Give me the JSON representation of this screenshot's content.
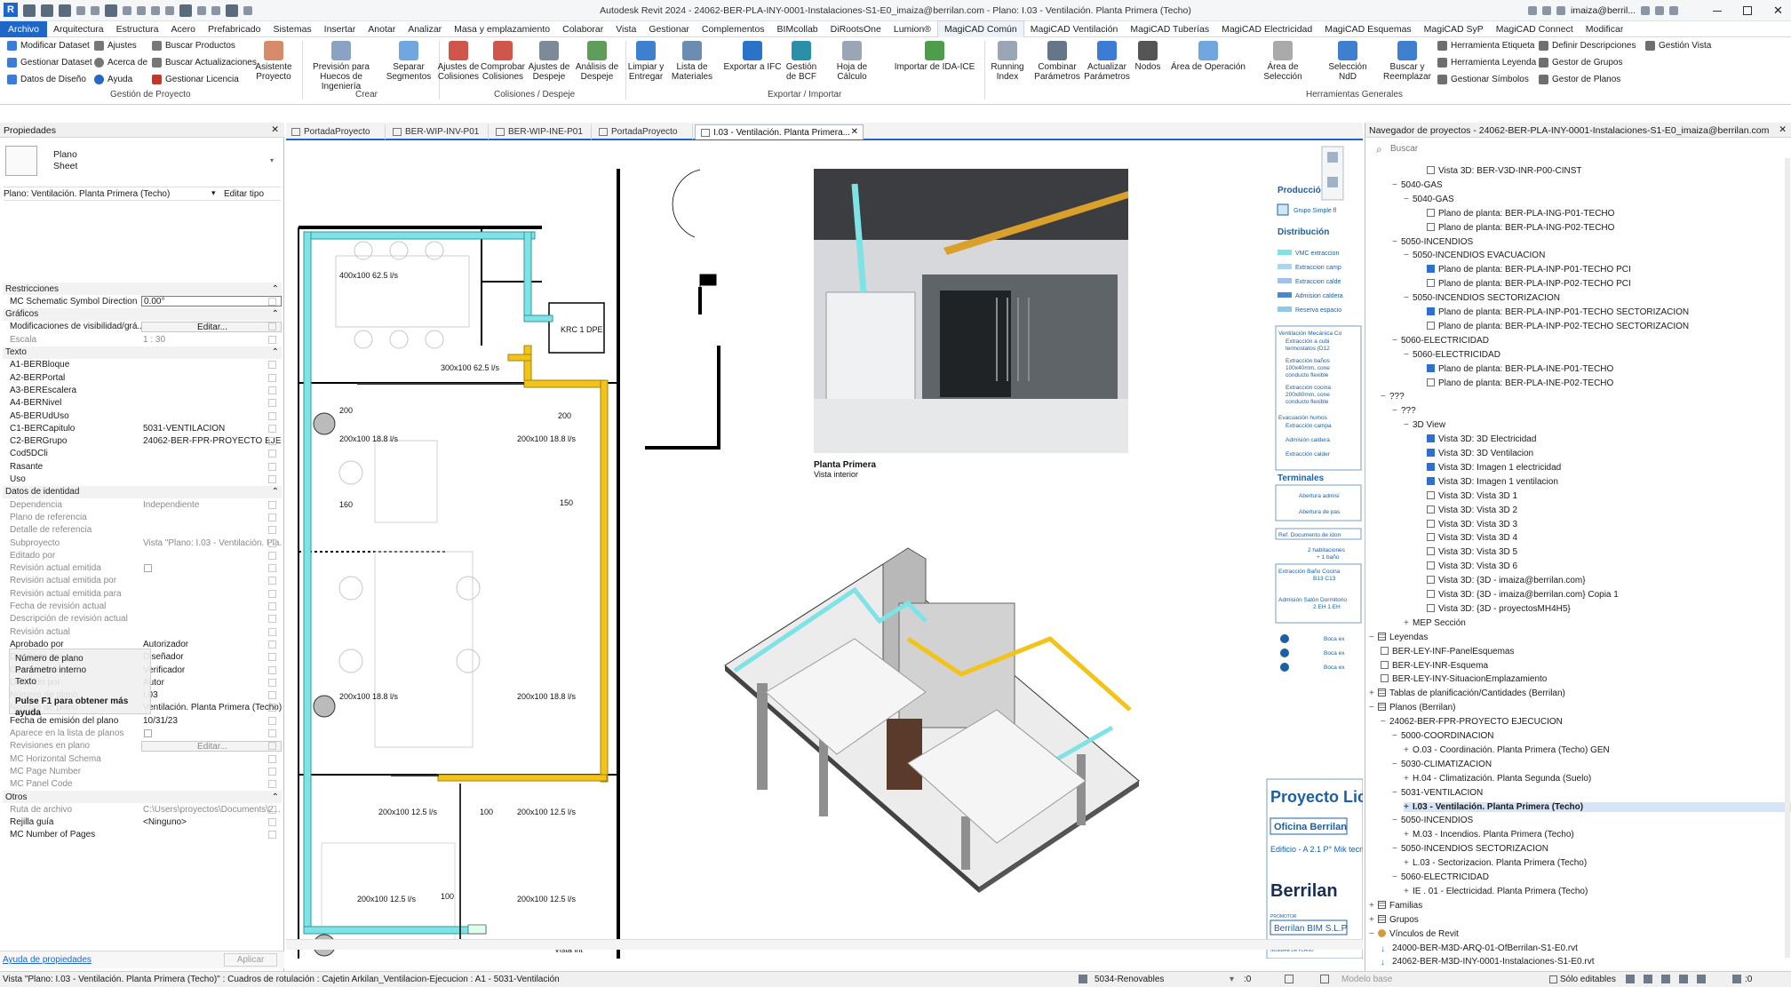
{
  "app": {
    "title": "Autodesk Revit 2024 - 24062-BER-PLA-INY-0001-Instalaciones-S1-E0_imaiza@berrilan.com - Plano: I.03 - Ventilación. Planta Primera (Techo)",
    "user": "imaiza@berril...",
    "logo": "R"
  },
  "menu": [
    "Archivo",
    "Arquitectura",
    "Estructura",
    "Acero",
    "Prefabricado",
    "Sistemas",
    "Insertar",
    "Anotar",
    "Analizar",
    "Masa y emplazamiento",
    "Colaborar",
    "Vista",
    "Gestionar",
    "Complementos",
    "BIMcollab",
    "DiRootsOne",
    "Lumion®",
    "MagiCAD Común",
    "MagiCAD Ventilación",
    "MagiCAD Tuberías",
    "MagiCAD Electricidad",
    "MagiCAD Esquemas",
    "MagiCAD SyP",
    "MagiCAD Connect",
    "Modificar"
  ],
  "ribbon": {
    "gestion_small": [
      "Modificar Dataset",
      "Gestionar Dataset",
      "Datos de Diseño",
      "Ajustes",
      "Acerca de",
      "Ayuda",
      "Buscar Productos",
      "Buscar Actualizaciones",
      "Gestionar Licencia"
    ],
    "asistente": "Asistente Proyecto",
    "crear": [
      "Previsión para Huecos de Ingeniería",
      "Separar Segmentos"
    ],
    "colisiones": [
      "Ajustes de Colisiones",
      "Comprobar Colisiones",
      "Ajustes de Despeje",
      "Análisis de Despeje"
    ],
    "exportar": [
      "Limpiar y Entregar",
      "Lista de Materiales",
      "Exportar a IFC",
      "Gestión de BCF",
      "Hoja de Cálculo",
      "Importar de IDA-ICE"
    ],
    "herramientas": [
      "Running Index",
      "Combinar Parámetros",
      "Actualizar Parámetros",
      "Nodos",
      "Área de Operación",
      "Área de Selección",
      "Selección NdD",
      "Buscar y Reemplazar"
    ],
    "herramientas_small": [
      "Herramienta Etiqueta",
      "Herramienta Leyenda",
      "Gestionar Símbolos",
      "Definir Descripciones",
      "Gestor de Grupos",
      "Gestor de Planos",
      "Gestión Vista"
    ],
    "groups": [
      "Gestión de Proyecto",
      "Crear",
      "Colisiones / Despeje",
      "Exportar / Importar",
      "Herramientas Generales"
    ]
  },
  "properties": {
    "header": "Propiedades",
    "type_name": "Plano",
    "type_sub": "Sheet",
    "selector": "Plano: Ventilación. Planta Primera (Techo)",
    "edit_type": "Editar tipo",
    "rows": [
      {
        "k": "Restricciones",
        "v": "",
        "cat": true
      },
      {
        "k": "MC Schematic Symbol Direction",
        "v": "0.00°",
        "box": true
      },
      {
        "k": "Gráficos",
        "v": "",
        "cat": true
      },
      {
        "k": "Modificaciones de visibilidad/grá...",
        "v": "Editar...",
        "btn": true
      },
      {
        "k": "Escala",
        "v": "1 : 30",
        "gray": true
      },
      {
        "k": "Texto",
        "v": "",
        "cat": true
      },
      {
        "k": "A1-BERBloque",
        "v": ""
      },
      {
        "k": "A2-BERPortal",
        "v": ""
      },
      {
        "k": "A3-BEREscalera",
        "v": ""
      },
      {
        "k": "A4-BERNivel",
        "v": ""
      },
      {
        "k": "A5-BERUdUso",
        "v": ""
      },
      {
        "k": "C1-BERCapitulo",
        "v": "5031-VENTILACION"
      },
      {
        "k": "C2-BERGrupo",
        "v": "24062-BER-FPR-PROYECTO EJECU..."
      },
      {
        "k": "Cod5DCli",
        "v": ""
      },
      {
        "k": "Rasante",
        "v": ""
      },
      {
        "k": "Uso",
        "v": ""
      },
      {
        "k": "Datos de identidad",
        "v": "",
        "cat": true
      },
      {
        "k": "Dependencia",
        "v": "Independiente",
        "gray": true
      },
      {
        "k": "Plano de referencia",
        "v": "",
        "gray": true
      },
      {
        "k": "Detalle de referencia",
        "v": "",
        "gray": true
      },
      {
        "k": "Subproyecto",
        "v": "Vista \"Plano: I.03 - Ventilación. Pla...",
        "gray": true
      },
      {
        "k": "Editado por",
        "v": "",
        "gray": true
      },
      {
        "k": "Revisión actual emitida",
        "v": "",
        "gray": true,
        "check": true
      },
      {
        "k": "Revisión actual emitida por",
        "v": "",
        "gray": true
      },
      {
        "k": "Revisión actual emitida para",
        "v": "",
        "gray": true
      },
      {
        "k": "Fecha de revisión actual",
        "v": "",
        "gray": true
      },
      {
        "k": "Descripción de revisión actual",
        "v": "",
        "gray": true
      },
      {
        "k": "Revisión actual",
        "v": "",
        "gray": true
      },
      {
        "k": "Aprobado por",
        "v": "Autorizador"
      },
      {
        "k": "Diseñado por",
        "v": "Diseñador"
      },
      {
        "k": "Comprobado por",
        "v": "Verificador"
      },
      {
        "k": "Dibujado por",
        "v": "Autor"
      },
      {
        "k": "Número de plano",
        "v": "I.03"
      },
      {
        "k": "Nombre de plano",
        "v": "Ventilación. Planta Primera (Techo)"
      },
      {
        "k": "Fecha de emisión del plano",
        "v": "10/31/23"
      },
      {
        "k": "Aparece en la lista de planos",
        "v": "",
        "check": true,
        "gray": true
      },
      {
        "k": "Revisiones en plano",
        "v": "Editar...",
        "btn": true,
        "gray": true
      },
      {
        "k": "MC Horizontal Schema",
        "v": "",
        "gray": true
      },
      {
        "k": "MC Page Number",
        "v": "",
        "gray": true
      },
      {
        "k": "MC Panel Code",
        "v": "",
        "gray": true
      },
      {
        "k": "Otros",
        "v": "",
        "cat": true
      },
      {
        "k": "Ruta de archivo",
        "v": "C:\\Users\\proyectos\\Documents\\2...",
        "gray": true
      },
      {
        "k": "Rejilla guía",
        "v": "<Ninguno>"
      },
      {
        "k": "MC Number of Pages",
        "v": ""
      }
    ],
    "tooltip": [
      "Número de plano",
      "Parámetro interno",
      "Texto"
    ],
    "tooltip_help": "Pulse F1 para obtener más ayuda",
    "help_link": "Ayuda de propiedades",
    "apply": "Aplicar"
  },
  "tabs": [
    {
      "label": "PortadaProyecto"
    },
    {
      "label": "BER-WIP-INV-P01"
    },
    {
      "label": "BER-WIP-INE-P01"
    },
    {
      "label": "PortadaProyecto"
    },
    {
      "label": "I.03 - Ventilación. Planta Primera..."
    }
  ],
  "drawing": {
    "plan_labels": [
      "400x100 62.5 l/s",
      "300x100 62.5 l/s",
      "200x100 18.8 l/s",
      "200x100 18.8 l/s",
      "200x100 18.8 l/s",
      "200x100 18.8 l/s",
      "200x100 12.5 l/s",
      "200x100 12.5 l/s",
      "200x100 12.5 l/s",
      "200x100 12.5 l/s",
      "200",
      "200",
      "160",
      "150",
      "100",
      "100",
      "KRC 1 DPE",
      "Vista int"
    ],
    "render_title": "Planta Primera",
    "render_sub": "Vista interior",
    "legend": {
      "produccion": "Producción",
      "grupo": "Grupo Simple fl",
      "distribucion": "Distribución",
      "dist_items": [
        "VMC extraccion",
        "Extraccion camp",
        "Extraccion calde",
        "Admision caldera",
        "Reserva espacio"
      ],
      "vent_note": [
        "Ventilación Mecánica Co",
        "Extracción a cubi",
        "termostatos (D12",
        "Extracción baños",
        "100x40mm, cone",
        "conducto flexible",
        "Extracción cocina",
        "200x80mm, cone",
        "conducto flexible"
      ],
      "evac": [
        "Evacuación humos",
        "Extracción campa",
        "Admisión caldera",
        "Extracción calder"
      ],
      "terminales": "Terminales",
      "term_items": [
        "Abertura admisi",
        "Abertura de pas"
      ],
      "ref": "Ref. Documento de idon",
      "hab": [
        "2 habitaciones",
        "+ 1 baño"
      ],
      "table": [
        "Extracción Baño Cocina",
        "B13 C13",
        "Admisión Salón Dormitorio",
        "2 EH 1 EH"
      ],
      "boca": [
        "Boca ex",
        "Boca ex",
        "Boca ex"
      ]
    },
    "title_block": {
      "project": "Proyecto Lic",
      "office": "Oficina Berrilan",
      "address": "Edificio - A 2.1 P° Mik tecnologico Miramon",
      "brand": "Berrilan",
      "promotor_label": "PROMOTOR",
      "promotor": "Berrilan BIM S.L.P",
      "consultor_label": "NOMBRE DE PLANO"
    }
  },
  "navigator": {
    "header": "Navegador de proyectos - 24062-BER-PLA-INY-0001-Instalaciones-S1-E0_imaiza@berrilan.com",
    "search_placeholder": "Buscar",
    "rows": [
      {
        "d": 4,
        "t": "Vista 3D: BER-V3D-INR-P00-CINST",
        "ic": "v"
      },
      {
        "d": 1,
        "t": "5040-GAS",
        "ex": "−"
      },
      {
        "d": 2,
        "t": "5040-GAS",
        "ex": "−"
      },
      {
        "d": 4,
        "t": "Plano de planta: BER-PLA-ING-P01-TECHO",
        "ic": "v"
      },
      {
        "d": 4,
        "t": "Plano de planta: BER-PLA-ING-P02-TECHO",
        "ic": "v"
      },
      {
        "d": 1,
        "t": "5050-INCENDIOS",
        "ex": "−"
      },
      {
        "d": 2,
        "t": "5050-INCENDIOS EVACUACION",
        "ex": "−"
      },
      {
        "d": 4,
        "t": "Plano de planta: BER-PLA-INP-P01-TECHO PCI",
        "ic": "b"
      },
      {
        "d": 4,
        "t": "Plano de planta: BER-PLA-INP-P02-TECHO PCI",
        "ic": "v"
      },
      {
        "d": 2,
        "t": "5050-INCENDIOS SECTORIZACION",
        "ex": "−"
      },
      {
        "d": 4,
        "t": "Plano de planta: BER-PLA-INP-P01-TECHO SECTORIZACION",
        "ic": "b"
      },
      {
        "d": 4,
        "t": "Plano de planta: BER-PLA-INP-P02-TECHO SECTORIZACION",
        "ic": "v"
      },
      {
        "d": 1,
        "t": "5060-ELECTRICIDAD",
        "ex": "−"
      },
      {
        "d": 2,
        "t": "5060-ELECTRICIDAD",
        "ex": "−"
      },
      {
        "d": 4,
        "t": "Plano de planta: BER-PLA-INE-P01-TECHO",
        "ic": "b"
      },
      {
        "d": 4,
        "t": "Plano de planta: BER-PLA-INE-P02-TECHO",
        "ic": "v"
      },
      {
        "d": 0,
        "t": "???",
        "ex": "−"
      },
      {
        "d": 1,
        "t": "???",
        "ex": "−"
      },
      {
        "d": 2,
        "t": "3D View",
        "ex": "−"
      },
      {
        "d": 4,
        "t": "Vista 3D: 3D Electricidad",
        "ic": "b"
      },
      {
        "d": 4,
        "t": "Vista 3D: 3D Ventilacion",
        "ic": "b"
      },
      {
        "d": 4,
        "t": "Vista 3D: Imagen 1 electricidad",
        "ic": "b"
      },
      {
        "d": 4,
        "t": "Vista 3D: Imagen 1 ventilacion",
        "ic": "b"
      },
      {
        "d": 4,
        "t": "Vista 3D: Vista 3D 1",
        "ic": "v"
      },
      {
        "d": 4,
        "t": "Vista 3D: Vista 3D 2",
        "ic": "v"
      },
      {
        "d": 4,
        "t": "Vista 3D: Vista 3D 3",
        "ic": "v"
      },
      {
        "d": 4,
        "t": "Vista 3D: Vista 3D 4",
        "ic": "v"
      },
      {
        "d": 4,
        "t": "Vista 3D: Vista 3D 5",
        "ic": "v"
      },
      {
        "d": 4,
        "t": "Vista 3D: Vista 3D 6",
        "ic": "v"
      },
      {
        "d": 4,
        "t": "Vista 3D: {3D - imaiza@berrilan.com}",
        "ic": "v"
      },
      {
        "d": 4,
        "t": "Vista 3D: {3D - imaiza@berrilan.com} Copia 1",
        "ic": "v"
      },
      {
        "d": 4,
        "t": "Vista 3D: {3D - proyectosMH4H5}",
        "ic": "v"
      },
      {
        "d": 2,
        "t": "MEP Sección",
        "ex": "+"
      },
      {
        "d": -1,
        "t": "Leyendas",
        "ex": "−",
        "ic": "t"
      },
      {
        "d": 0,
        "t": "BER-LEY-INF-PanelEsquemas",
        "ic": "v"
      },
      {
        "d": 0,
        "t": "BER-LEY-INR-Esquema",
        "ic": "v"
      },
      {
        "d": 0,
        "t": "BER-LEY-INY-SituacionEmplazamiento",
        "ic": "v"
      },
      {
        "d": -1,
        "t": "Tablas de planificación/Cantidades (Berrilan)",
        "ex": "+",
        "ic": "t"
      },
      {
        "d": -1,
        "t": "Planos (Berrilan)",
        "ex": "−",
        "ic": "t"
      },
      {
        "d": 0,
        "t": "24062-BER-FPR-PROYECTO EJECUCION",
        "ex": "−"
      },
      {
        "d": 1,
        "t": "5000-COORDINACION",
        "ex": "−"
      },
      {
        "d": 2,
        "t": "O.03 - Coordinación. Planta Primera (Techo) GEN",
        "ex": "+"
      },
      {
        "d": 1,
        "t": "5030-CLIMATIZACION",
        "ex": "−"
      },
      {
        "d": 2,
        "t": "H.04 - Climatización. Planta Segunda (Suelo)",
        "ex": "+"
      },
      {
        "d": 1,
        "t": "5031-VENTILACION",
        "ex": "−"
      },
      {
        "d": 2,
        "t": "I.03 - Ventilación. Planta Primera (Techo)",
        "ex": "+",
        "sel": true
      },
      {
        "d": 1,
        "t": "5050-INCENDIOS",
        "ex": "−"
      },
      {
        "d": 2,
        "t": "M.03 - Incendios. Planta Primera (Techo)",
        "ex": "+"
      },
      {
        "d": 1,
        "t": "5050-INCENDIOS SECTORIZACION",
        "ex": "−"
      },
      {
        "d": 2,
        "t": "L.03 - Sectorizacion. Planta Primera (Techo)",
        "ex": "+"
      },
      {
        "d": 1,
        "t": "5060-ELECTRICIDAD",
        "ex": "−"
      },
      {
        "d": 2,
        "t": "IE . 01 - Electricidad. Planta Primera (Techo)",
        "ex": "+"
      },
      {
        "d": -1,
        "t": "Familias",
        "ex": "+",
        "ic": "t"
      },
      {
        "d": -1,
        "t": "Grupos",
        "ex": "+",
        "ic": "t"
      },
      {
        "d": -1,
        "t": "Vínculos de Revit",
        "ex": "−",
        "ic": "l"
      },
      {
        "d": 0,
        "t": "24000-BER-M3D-ARQ-01-OfBerrilan-S1-E0.rvt",
        "ic": "a"
      },
      {
        "d": 0,
        "t": "24062-BER-M3D-INY-0001-Instalaciones-S1-E0.rvt",
        "ic": "a"
      }
    ]
  },
  "status": {
    "text": "Vista \"Plano: I.03 - Ventilación. Planta Primera (Techo)\" : Cuadros de rotulación : Cajetin Arkilan_Ventilacion-Ejecucion : A1 - 5031-Ventilación",
    "workset": "5034-Renovables",
    "zero": ":0",
    "model": "Modelo base",
    "editables": "Sólo editables",
    "filter": ":0"
  },
  "colors": {
    "accent": "#1e66c8",
    "duct_yellow": "#f2c318",
    "duct_cyan": "#7fe3e6"
  }
}
